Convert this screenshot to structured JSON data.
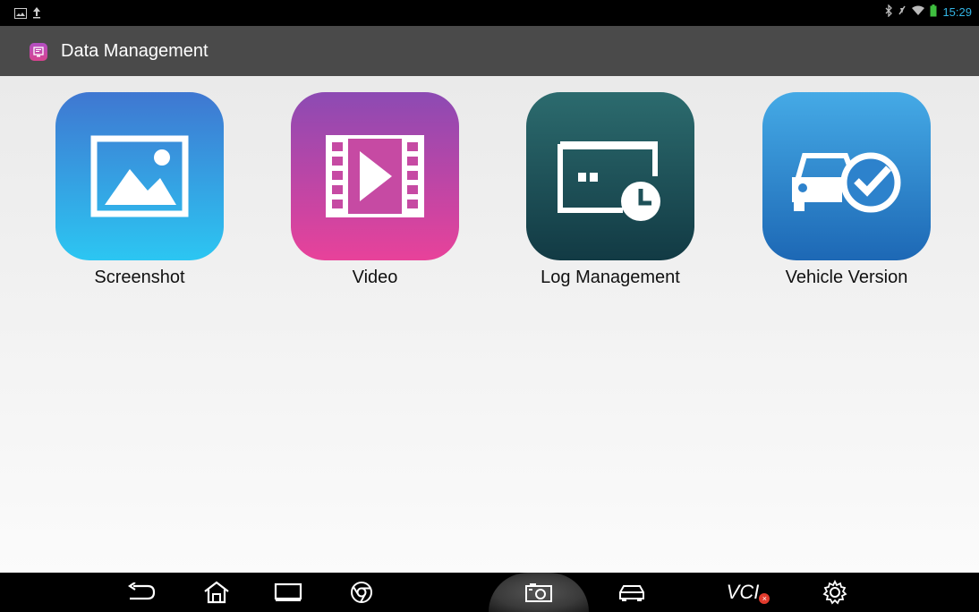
{
  "status_bar": {
    "time": "15:29"
  },
  "header": {
    "title": "Data Management"
  },
  "tiles": [
    {
      "label": "Screenshot",
      "icon": "image-icon",
      "gradient": [
        "#3f77d1",
        "#2cc6f2"
      ]
    },
    {
      "label": "Video",
      "icon": "video-icon",
      "gradient": [
        "#8c4ab3",
        "#e8429a"
      ]
    },
    {
      "label": "Log Management",
      "icon": "log-clock-icon",
      "gradient": [
        "#2c6b6e",
        "#123a44"
      ]
    },
    {
      "label": "Vehicle Version",
      "icon": "car-check-icon",
      "gradient": [
        "#45aae6",
        "#1d68b5"
      ]
    }
  ],
  "nav_bar": {
    "items": [
      "back-icon",
      "home-icon",
      "recent-apps-icon",
      "browser-icon",
      "camera-icon",
      "car-icon",
      "vci-icon",
      "settings-icon"
    ],
    "vci_label": "VCI",
    "vci_badge": "×"
  }
}
